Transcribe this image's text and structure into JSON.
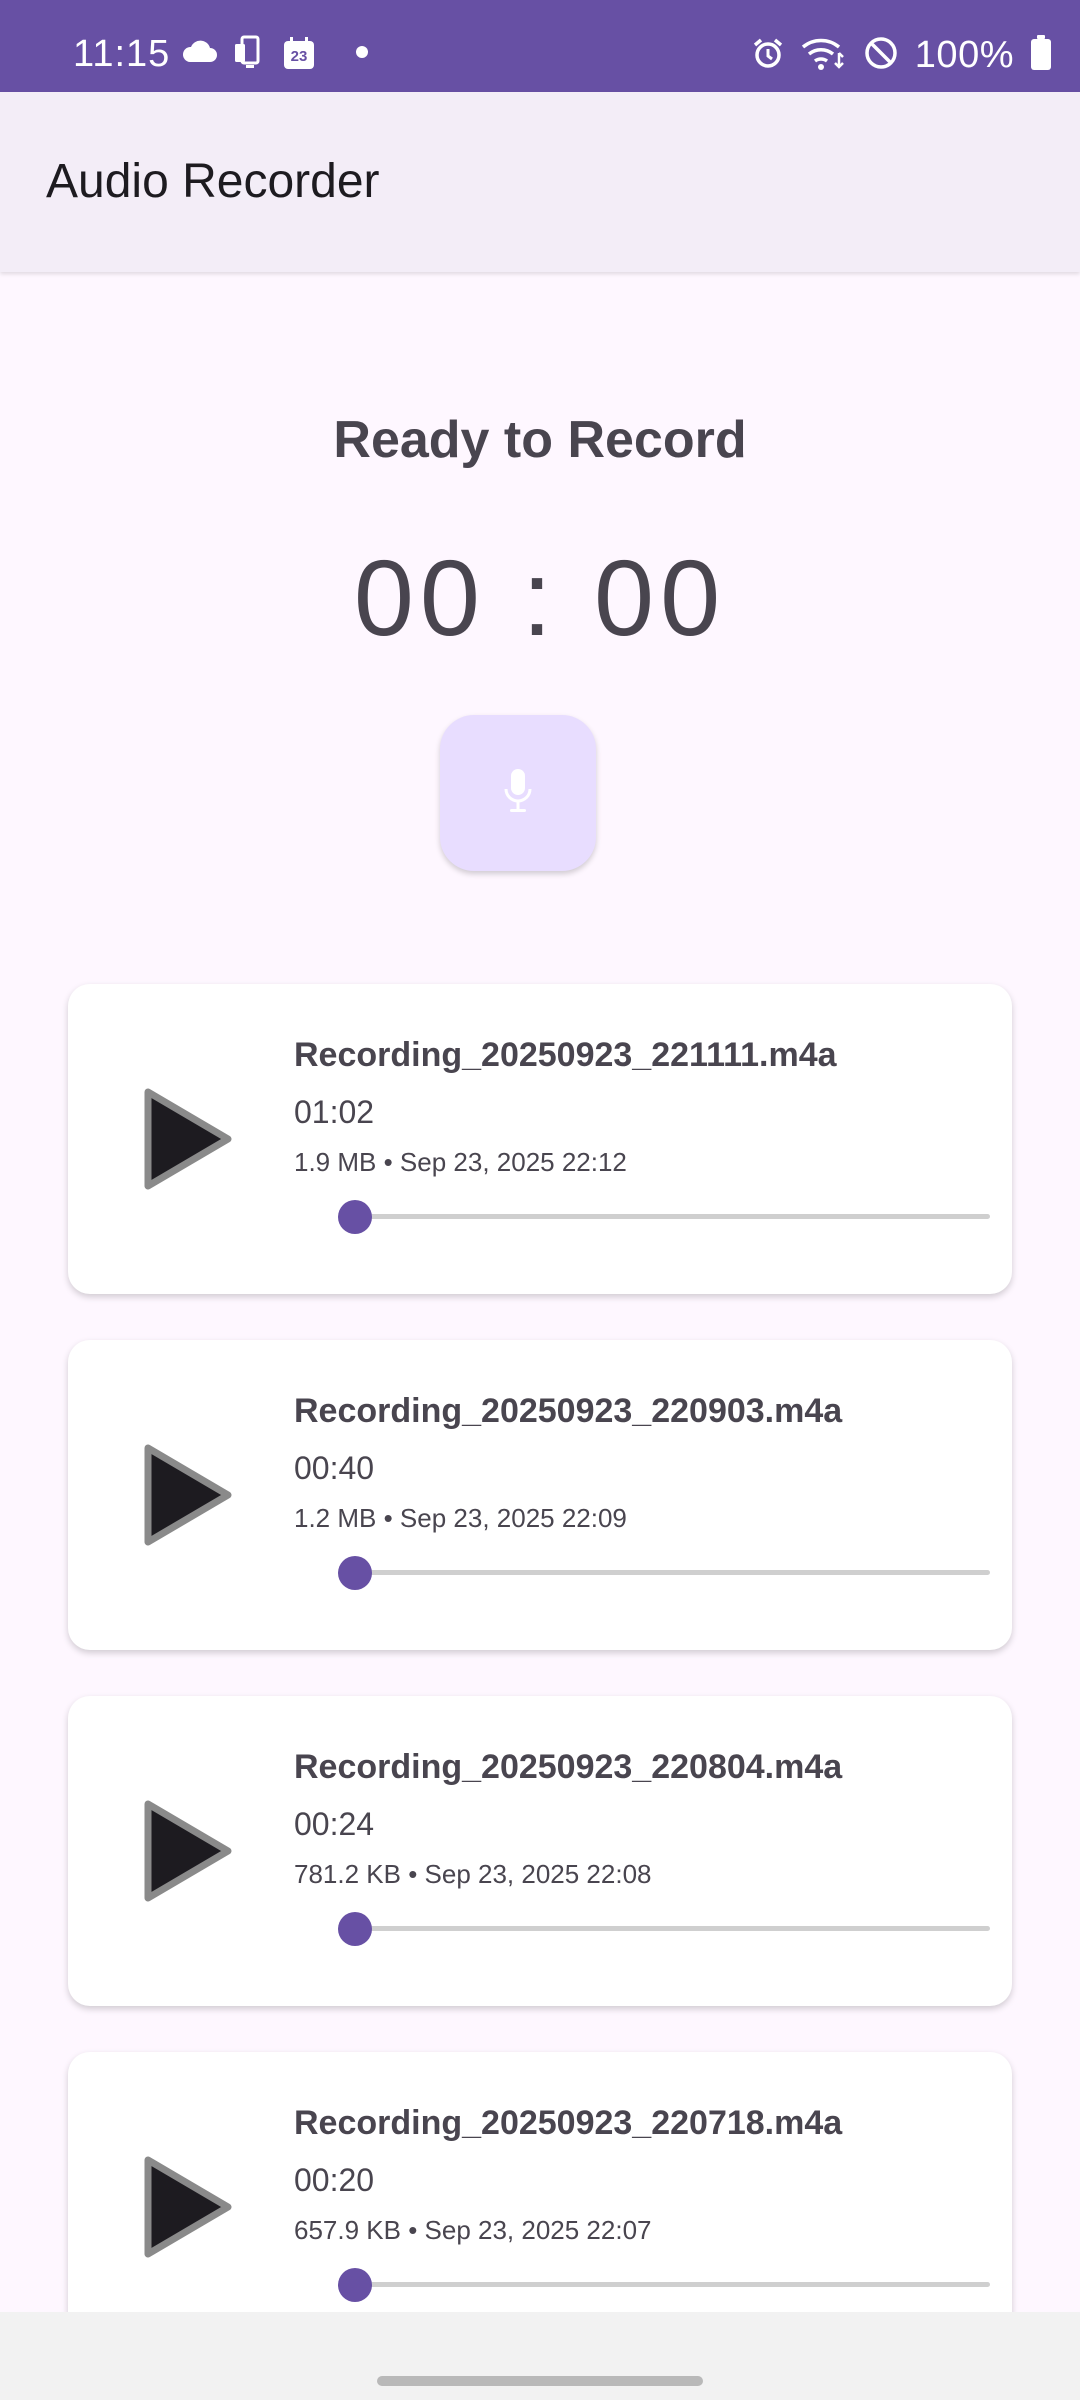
{
  "status_bar": {
    "time": "11:15",
    "battery": "100%",
    "left_icons": [
      "cloud-icon",
      "device-transfer-icon",
      "calendar-icon",
      "dot-icon"
    ],
    "calendar_day": "23",
    "right_icons": [
      "alarm-icon",
      "wifi-icon",
      "do-not-disturb-icon",
      "battery-icon"
    ]
  },
  "app_bar": {
    "title": "Audio Recorder"
  },
  "recorder": {
    "status": "Ready to Record",
    "timer": "00 : 00",
    "record_icon": "microphone-icon"
  },
  "recordings": [
    {
      "name": "Recording_20250923_221111.m4a",
      "duration": "01:02",
      "meta": "1.9 MB • Sep 23, 2025 22:12",
      "progress": 0
    },
    {
      "name": "Recording_20250923_220903.m4a",
      "duration": "00:40",
      "meta": "1.2 MB • Sep 23, 2025 22:09",
      "progress": 0
    },
    {
      "name": "Recording_20250923_220804.m4a",
      "duration": "00:24",
      "meta": "781.2 KB • Sep 23, 2025 22:08",
      "progress": 0
    },
    {
      "name": "Recording_20250923_220718.m4a",
      "duration": "00:20",
      "meta": "657.9 KB • Sep 23, 2025 22:07",
      "progress": 0
    }
  ],
  "colors": {
    "primary": "#6750a4",
    "record_button": "#e8ddff",
    "app_bar": "#f3edf7",
    "background": "#fef7ff"
  }
}
